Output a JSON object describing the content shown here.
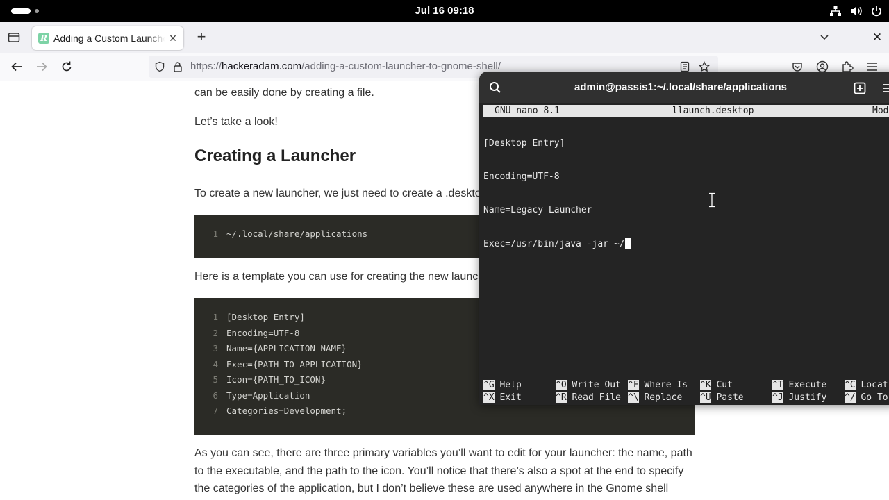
{
  "topbar": {
    "clock": "Jul 16  09:18"
  },
  "browser": {
    "tab": {
      "title": "Adding a Custom Launcher to Gnome Shell",
      "favicon_letter": "R"
    },
    "url": {
      "scheme": "https://",
      "host": "hackeradam.com",
      "path": "/adding-a-custom-launcher-to-gnome-shell/"
    }
  },
  "page": {
    "intro_tail": "can be easily done by creating a file.",
    "look": "Let’s take a look!",
    "heading": "Creating a Launcher",
    "para1": "To create a new launcher, we just need to create a .desktop",
    "code1": [
      {
        "n": "1",
        "text": "~/.local/share/applications"
      }
    ],
    "para2": "Here is a template you can use for creating the new launch",
    "code2": [
      {
        "n": "1",
        "text": "[Desktop Entry]"
      },
      {
        "n": "2",
        "text": "Encoding=UTF-8"
      },
      {
        "n": "3",
        "text": "Name={APPLICATION_NAME}"
      },
      {
        "n": "4",
        "text": "Exec={PATH_TO_APPLICATION}"
      },
      {
        "n": "5",
        "text": "Icon={PATH_TO_ICON}"
      },
      {
        "n": "6",
        "text": "Type=Application"
      },
      {
        "n": "7",
        "text": "Categories=Development;"
      }
    ],
    "para3_line1": "As you can see, there are three primary variables you’ll want to edit for your launcher: the name, path",
    "para3_line2": "to the executable, and the path to the icon. You’ll notice that there’s also a spot at the end to specify",
    "para3_line3": "the categories of the application, but I don’t believe these are used anywhere in the Gnome shell"
  },
  "terminal": {
    "title": "admin@passis1:~/.local/share/applications",
    "nano": {
      "version": "GNU nano 8.1",
      "filename": "llaunch.desktop",
      "status": "Mod",
      "lines": [
        "[Desktop Entry]",
        "Encoding=UTF-8",
        "Name=Legacy Launcher",
        "Exec=/usr/bin/java -jar ~/"
      ],
      "shortcuts_row1": [
        {
          "key": "^G",
          "label": "Help"
        },
        {
          "key": "^O",
          "label": "Write Out"
        },
        {
          "key": "^F",
          "label": "Where Is"
        },
        {
          "key": "^K",
          "label": "Cut"
        },
        {
          "key": "^T",
          "label": "Execute"
        },
        {
          "key": "^C",
          "label": "Locat"
        }
      ],
      "shortcuts_row2": [
        {
          "key": "^X",
          "label": "Exit"
        },
        {
          "key": "^R",
          "label": "Read File"
        },
        {
          "key": "^\\",
          "label": "Replace"
        },
        {
          "key": "^U",
          "label": "Paste"
        },
        {
          "key": "^J",
          "label": "Justify"
        },
        {
          "key": "^/",
          "label": "Go To"
        }
      ]
    }
  }
}
